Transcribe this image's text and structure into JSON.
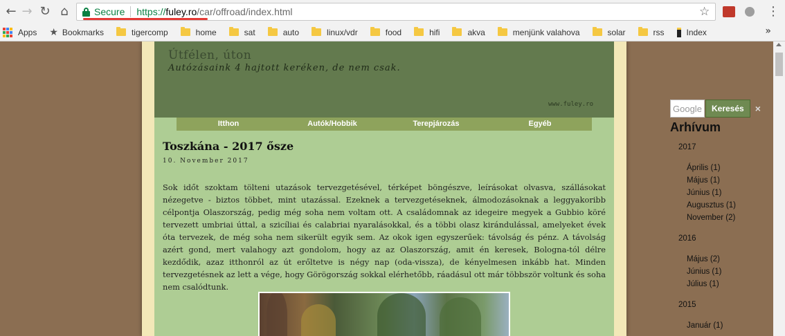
{
  "browser": {
    "secure_label": "Secure",
    "url_proto": "https://",
    "url_host": "fuley.ro",
    "url_path": "/car/offroad/index.html"
  },
  "bookmarks": [
    {
      "label": "Apps",
      "icon": "apps-grid-icon"
    },
    {
      "label": "Bookmarks",
      "icon": "star-icon"
    },
    {
      "label": "tigercomp",
      "icon": "folder-icon"
    },
    {
      "label": "home",
      "icon": "folder-icon"
    },
    {
      "label": "sat",
      "icon": "folder-icon"
    },
    {
      "label": "auto",
      "icon": "folder-icon"
    },
    {
      "label": "linux/vdr",
      "icon": "folder-icon"
    },
    {
      "label": "food",
      "icon": "folder-icon"
    },
    {
      "label": "hifi",
      "icon": "folder-icon"
    },
    {
      "label": "akva",
      "icon": "folder-icon"
    },
    {
      "label": "menjünk valahova",
      "icon": "folder-icon"
    },
    {
      "label": "solar",
      "icon": "folder-icon"
    },
    {
      "label": "rss",
      "icon": "folder-icon"
    },
    {
      "label": "Index",
      "icon": "index-icon"
    }
  ],
  "blog": {
    "title": "Útfélen, úton",
    "description": "Autózásaink 4 hajtott keréken, de nem csak.",
    "site_url": "www.fuley.ro"
  },
  "nav": [
    "Itthon",
    "Autók/Hobbik",
    "Terepjározás",
    "Egyéb"
  ],
  "post": {
    "title": "Toszkána - 2017 ősze",
    "date": "10. November 2017",
    "body": "Sok időt szoktam tölteni utazások tervezgetésével, térképet böngészve, leírásokat olvasva, szállásokat nézegetve - biztos többet, mint utazással. Ezeknek a tervezgetéseknek, álmodozásoknak a leggyakoribb célpontja Olaszország, pedig még soha nem voltam ott. A családomnak az idegeire megyek a Gubbio köré tervezett umbriai úttal, a szicíliai és calabriai nyaralásokkal, és a többi olasz kirándulással, amelyeket évek óta tervezek, de még soha nem sikerült egyik sem. Az okok igen egyszerűek: távolság és pénz. A távolság azért gond, mert valahogy azt gondolom, hogy az az Olaszország, amit én keresek, Bologna-tól délre kezdődik, azaz itthonról az út erőltetve is négy nap (oda-vissza), de kényelmesen inkább hat. Minden tervezgetésnek az lett a vége, hogy Görögország sokkal elérhetőbb, ráadásul ott már többször voltunk és soha nem csalódtunk."
  },
  "sidebar": {
    "search_placeholder": "Google",
    "search_button": "Keresés",
    "search_close": "×",
    "archive_title": "Arhívum",
    "years": [
      {
        "year": "2017",
        "months": [
          "Április (1)",
          "Május (1)",
          "Június (1)",
          "Augusztus (1)",
          "November (2)"
        ]
      },
      {
        "year": "2016",
        "months": [
          "Május (2)",
          "Június (1)",
          "Július (1)"
        ]
      },
      {
        "year": "2015",
        "months": [
          "Január (1)"
        ]
      }
    ]
  }
}
